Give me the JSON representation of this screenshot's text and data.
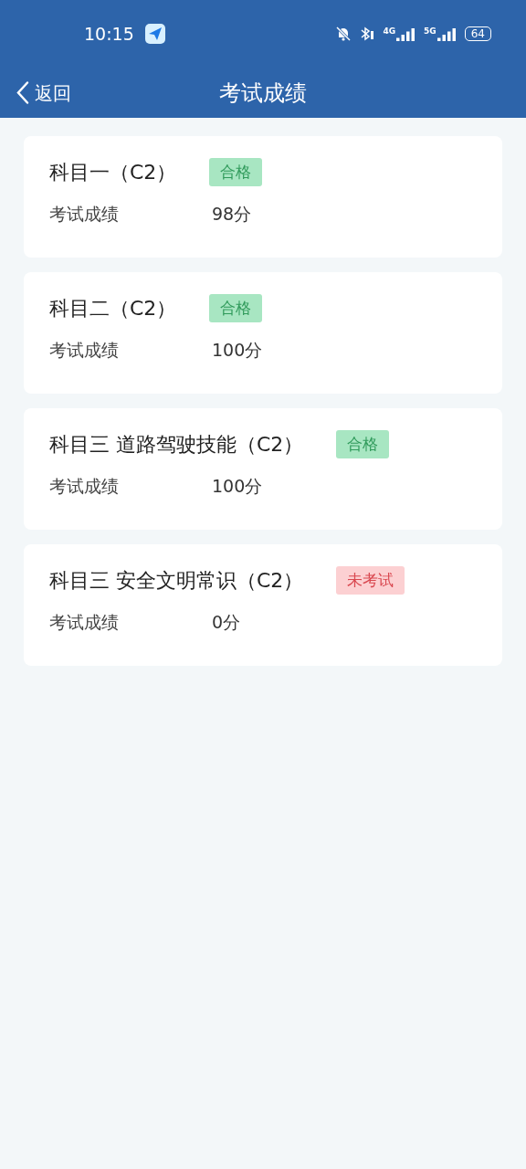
{
  "status_bar": {
    "time": "10:15",
    "networks": [
      "4G",
      "5G"
    ],
    "battery": "64"
  },
  "header": {
    "back": "返回",
    "title": "考试成绩"
  },
  "results": [
    {
      "subject": "科目一（C2）",
      "status": "合格",
      "kind": "passed",
      "label": "考试成绩",
      "score": "98分"
    },
    {
      "subject": "科目二（C2）",
      "status": "合格",
      "kind": "passed",
      "label": "考试成绩",
      "score": "100分"
    },
    {
      "subject": "科目三 道路驾驶技能（C2）",
      "status": "合格",
      "kind": "passed",
      "label": "考试成绩",
      "score": "100分"
    },
    {
      "subject": "科目三 安全文明常识（C2）",
      "status": "未考试",
      "kind": "untaken",
      "label": "考试成绩",
      "score": "0分"
    }
  ]
}
